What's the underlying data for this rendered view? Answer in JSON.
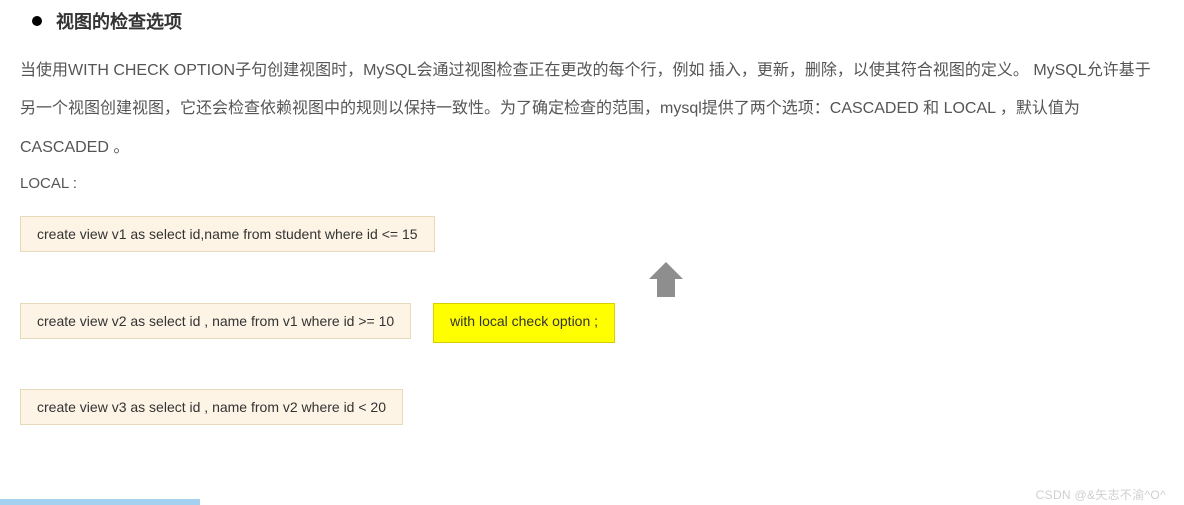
{
  "heading": "视图的检查选项",
  "paragraph": "当使用WITH CHECK OPTION子句创建视图时，MySQL会通过视图检查正在更改的每个行，例如 插入，更新，删除，以使其符合视图的定义。 MySQL允许基于另一个视图创建视图，它还会检查依赖视图中的规则以保持一致性。为了确定检查的范围，mysql提供了两个选项：CASCADED 和 LOCAL ，默认值为 CASCADED 。",
  "localLabel": "LOCAL :",
  "code1": "create view v1 as select id,name from student where id <= 15",
  "code2": "create view v2 as select id , name from v1 where id >= 10",
  "highlight": "with local check option ;",
  "code3": "create view v3 as select id , name from v2 where id  < 20",
  "watermark": "CSDN @&矢志不渝^O^"
}
